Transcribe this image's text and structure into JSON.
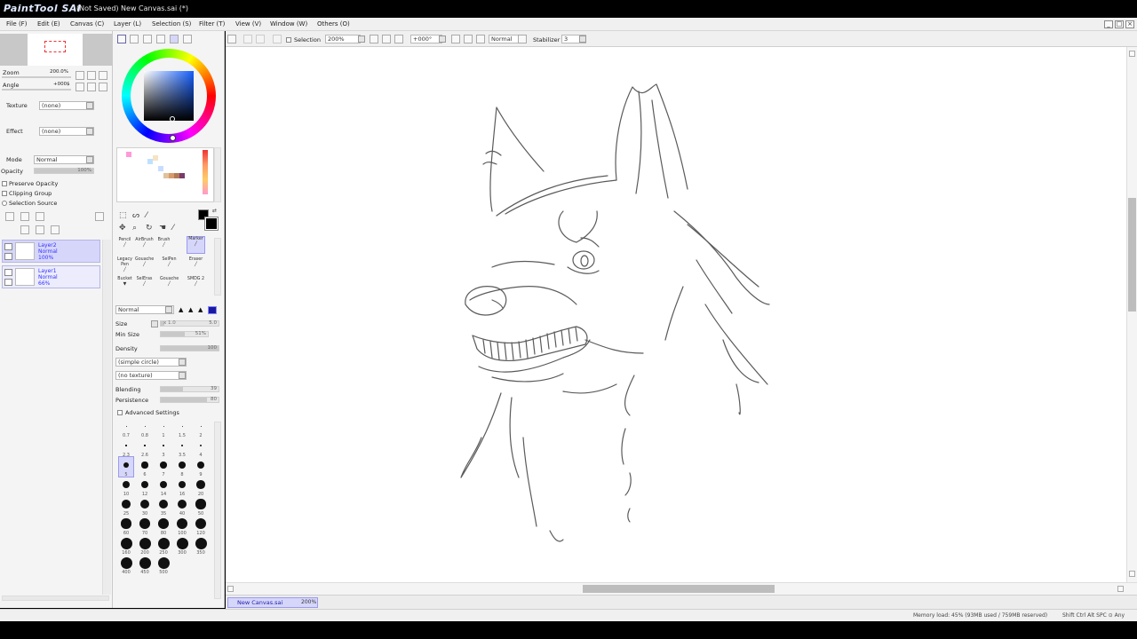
{
  "window": {
    "logo": "PaintTool SAI",
    "title": "(Not Saved) New Canvas.sai (*)"
  },
  "menu": [
    "File (F)",
    "Edit (E)",
    "Canvas (C)",
    "Layer (L)",
    "Selection (S)",
    "Filter (T)",
    "View (V)",
    "Window (W)",
    "Others (O)"
  ],
  "navigator": {
    "zoom_label": "Zoom",
    "zoom_value": "200.0%",
    "angle_label": "Angle",
    "angle_value": "+000$"
  },
  "layer_props": {
    "texture_label": "Texture",
    "texture_value": "(none)",
    "effect_label": "Effect",
    "effect_value": "(none)",
    "mode_label": "Mode",
    "mode_value": "Normal",
    "opacity_label": "Opacity",
    "opacity_value": "100%",
    "preserve_opacity": "Preserve Opacity",
    "clipping_group": "Clipping Group",
    "selection_source": "Selection Source"
  },
  "layers": [
    {
      "name": "Layer2",
      "mode": "Normal",
      "opacity": "100%",
      "selected": true
    },
    {
      "name": "Layer1",
      "mode": "Normal",
      "opacity": "66%",
      "selected": false
    }
  ],
  "toolbar": {
    "selection_label": "Selection",
    "zoom_value": "200%",
    "angle_value": "+000°",
    "mode_value": "Normal",
    "stabilizer_label": "Stabilizer",
    "stabilizer_value": "3"
  },
  "tools": [
    [
      "Pencil",
      "AirBrush",
      "Brush",
      "Marker"
    ],
    [
      "Legacy Pen",
      "Gouache",
      "SelPen",
      "Eraser"
    ],
    [
      "Bucket",
      "SelEras",
      "Gouache",
      "SMDG 2"
    ]
  ],
  "brush": {
    "mode_value": "Normal",
    "size_label": "Size",
    "size_mult": "x 1.0",
    "size_value": "5.0",
    "minsize_label": "Min Size",
    "minsize_value": "51%",
    "density_label": "Density",
    "density_value": "100",
    "shape_value": "(simple circle)",
    "texture_value": "(no texture)",
    "blending_label": "Blending",
    "blending_value": "39",
    "persistence_label": "Persistence",
    "persistence_value": "80",
    "advanced_label": "Advanced Settings",
    "dot_size_labels": [
      [
        "0.7",
        "0.8",
        "1",
        "1.5",
        "2"
      ],
      [
        "2.3",
        "2.6",
        "3",
        "3.5",
        "4"
      ],
      [
        "5",
        "6",
        "7",
        "8",
        "9"
      ],
      [
        "10",
        "12",
        "14",
        "16",
        "20"
      ],
      [
        "25",
        "30",
        "35",
        "40",
        "50"
      ],
      [
        "60",
        "70",
        "80",
        "100",
        "120"
      ],
      [
        "160",
        "200",
        "250",
        "300",
        "350"
      ],
      [
        "400",
        "450",
        "500"
      ]
    ],
    "dot_selected": "5"
  },
  "tab": {
    "name": "New Canvas.sai",
    "zoom": "200%"
  },
  "status": {
    "memory": "Memory load: 45% (93MB used / 759MB reserved)",
    "keys": "Shift Ctrl Alt SPC ⊙ Any"
  },
  "colors": {
    "canvas_bg": "#ffffff",
    "panel_bg": "#f4f4f4",
    "layer_selected": "#d6d6fb",
    "sketch_line": "#5a5a5a",
    "primary_color": "#000000"
  }
}
